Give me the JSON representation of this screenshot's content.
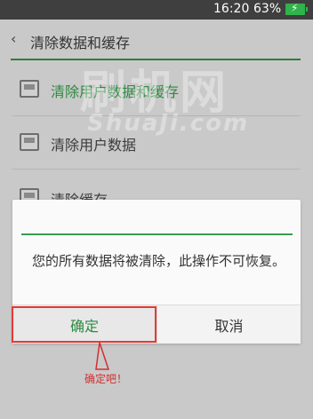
{
  "status_bar": {
    "time": "16:20",
    "battery": "63%",
    "icon": "battery-charging-icon"
  },
  "header": {
    "back_icon": "chevron-left-icon",
    "title": "清除数据和缓存"
  },
  "menu": [
    {
      "label": "清除用户数据和缓存",
      "icon": "broom-icon"
    },
    {
      "label": "清除用户数据",
      "icon": "user-data-icon"
    },
    {
      "label": "清除缓存",
      "icon": "cache-icon"
    }
  ],
  "watermark": {
    "cn": "刷机网",
    "en": "ShuaJi.com"
  },
  "dialog": {
    "message": "您的所有数据将被清除，此操作不可恢复。",
    "confirm": "确定",
    "cancel": "取消"
  },
  "annotation": {
    "text": "确定吧！"
  },
  "colors": {
    "accent": "#2b8a3e",
    "annotation": "#d32f2f",
    "status_bar": "#3f3f3f"
  }
}
